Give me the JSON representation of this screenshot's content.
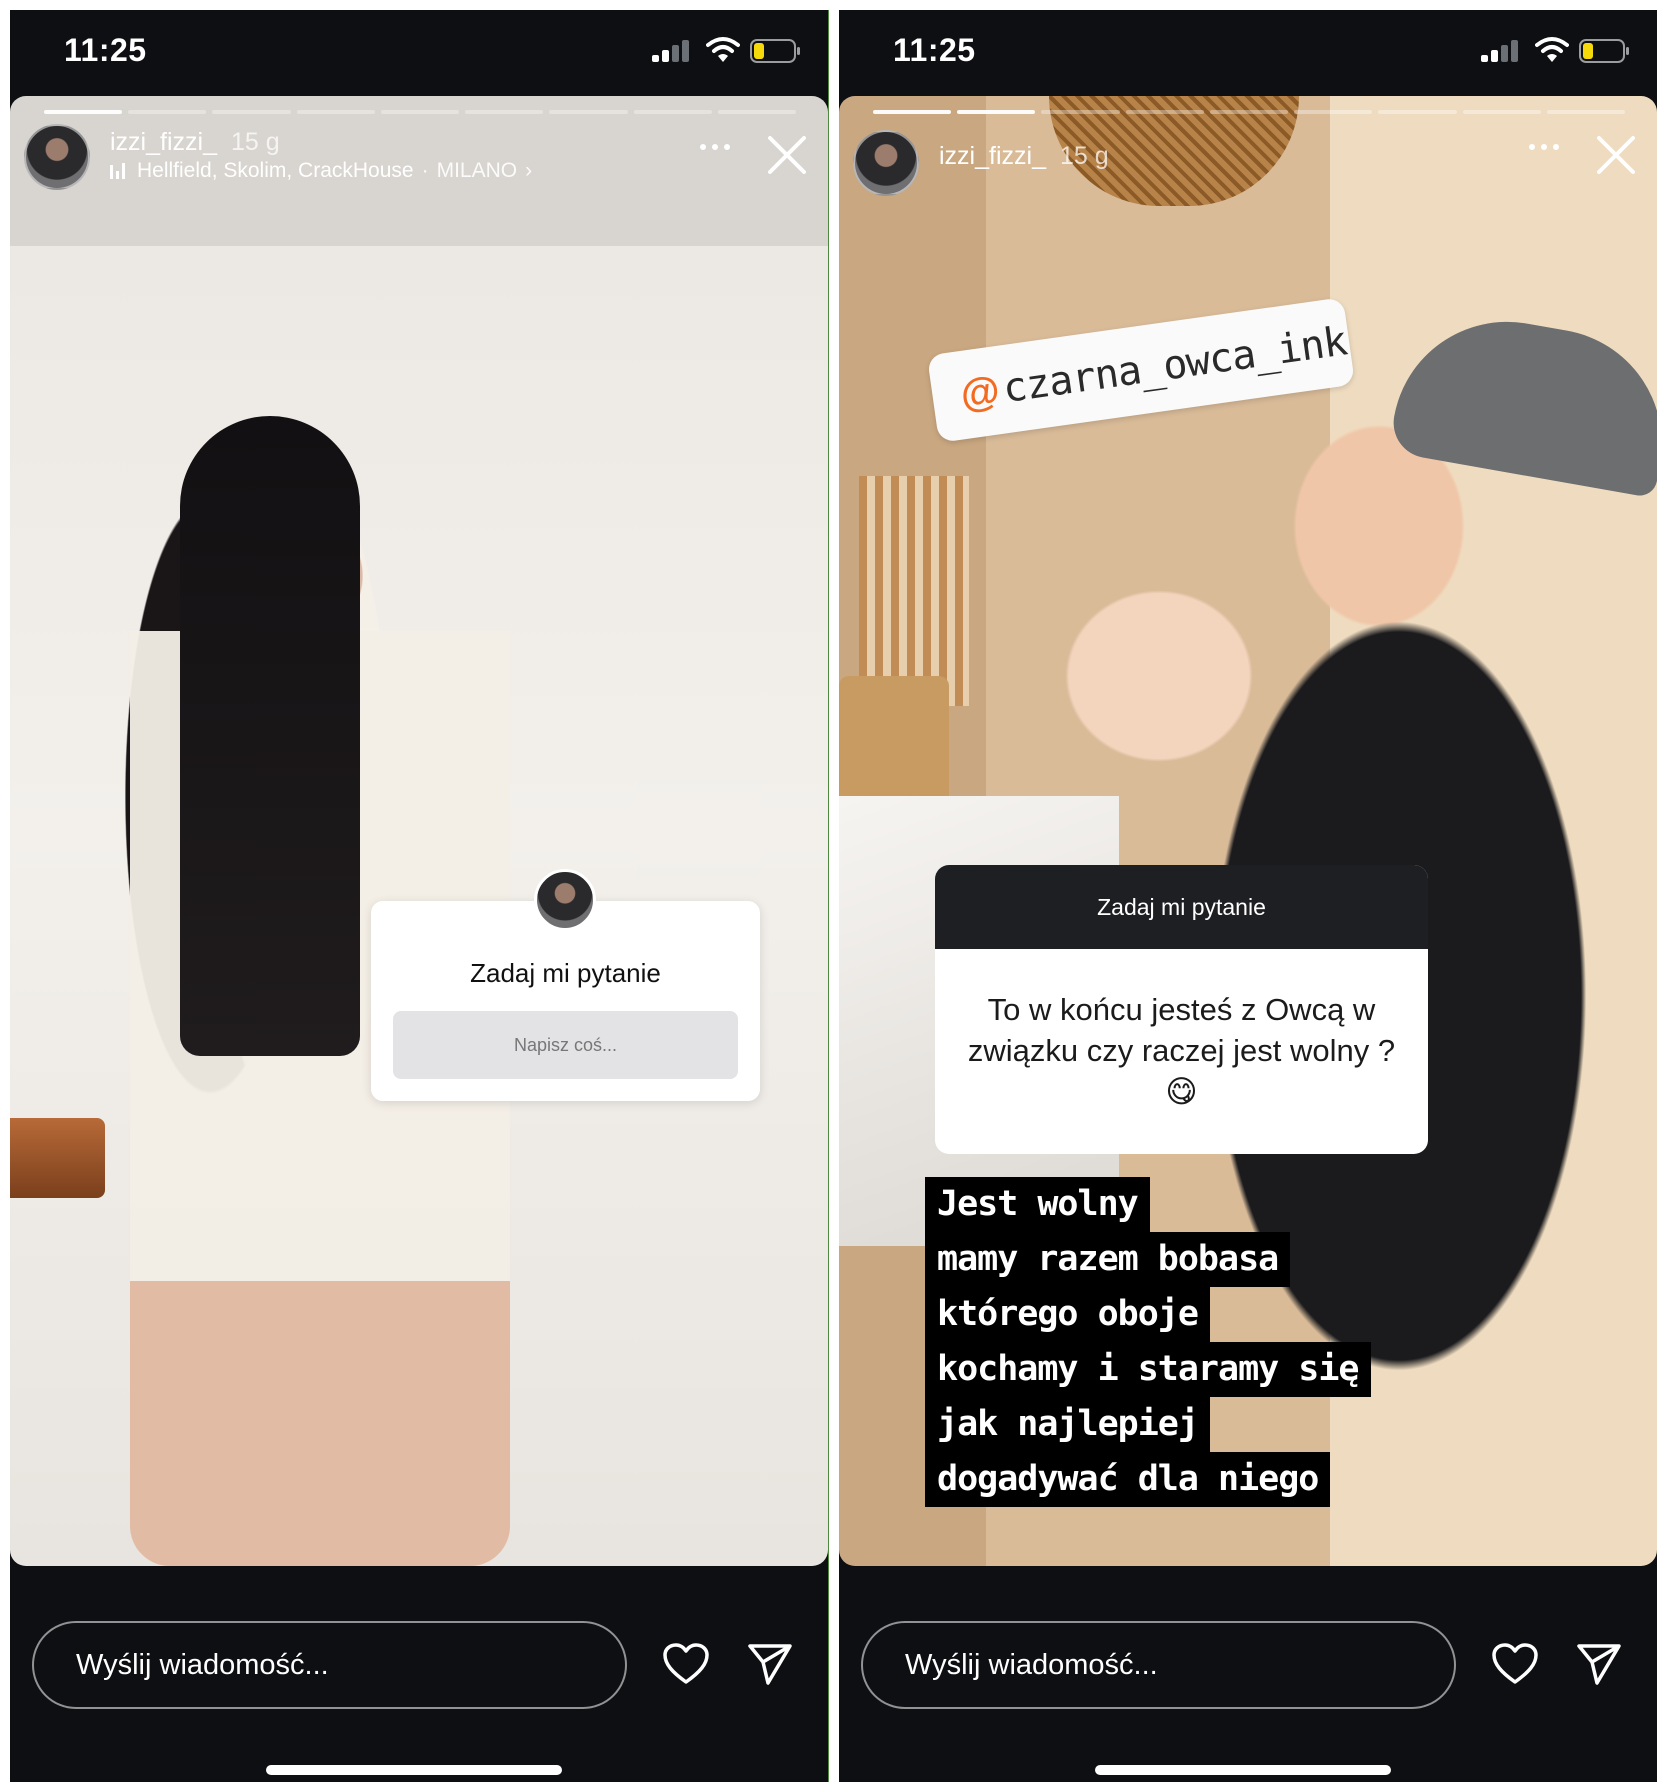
{
  "left": {
    "status": {
      "time": "11:25"
    },
    "header": {
      "username": "izzi_fizzi_",
      "time_ago": "15 g",
      "music": "Hellfield, Skolim, CrackHouse",
      "separator": "·",
      "location": "MILANO",
      "location_chevron": "›"
    },
    "progress": {
      "total": 9,
      "current": 1
    },
    "question": {
      "title": "Zadaj mi pytanie",
      "placeholder": "Napisz coś..."
    },
    "reply": {
      "placeholder": "Wyślij wiadomość..."
    }
  },
  "right": {
    "status": {
      "time": "11:25"
    },
    "header": {
      "username": "izzi_fizzi_",
      "time_ago": "15 g"
    },
    "progress": {
      "total": 9,
      "current": 2
    },
    "mention": {
      "at": "@",
      "handle": "czarna_owca_ink"
    },
    "question": {
      "title": "Zadaj mi pytanie",
      "text": "To w końcu jesteś z Owcą w związku czy raczej jest wolny ? 😋"
    },
    "answer_lines": [
      "Jest wolny",
      "mamy razem bobasa",
      "którego oboje",
      "kochamy i staramy się",
      "jak najlepiej",
      "dogadywać dla niego"
    ],
    "reply": {
      "placeholder": "Wyślij wiadomość..."
    }
  },
  "icons": {
    "signal": "signal-icon",
    "wifi": "wifi-icon",
    "battery": "battery-icon",
    "music": "music-bars-icon",
    "more": "more-dots-icon",
    "close": "close-icon",
    "heart": "heart-icon",
    "send": "send-icon"
  },
  "colors": {
    "battery_level": "#f5d90a",
    "mention_at": "#f26b21",
    "background": "#0d0f12"
  }
}
